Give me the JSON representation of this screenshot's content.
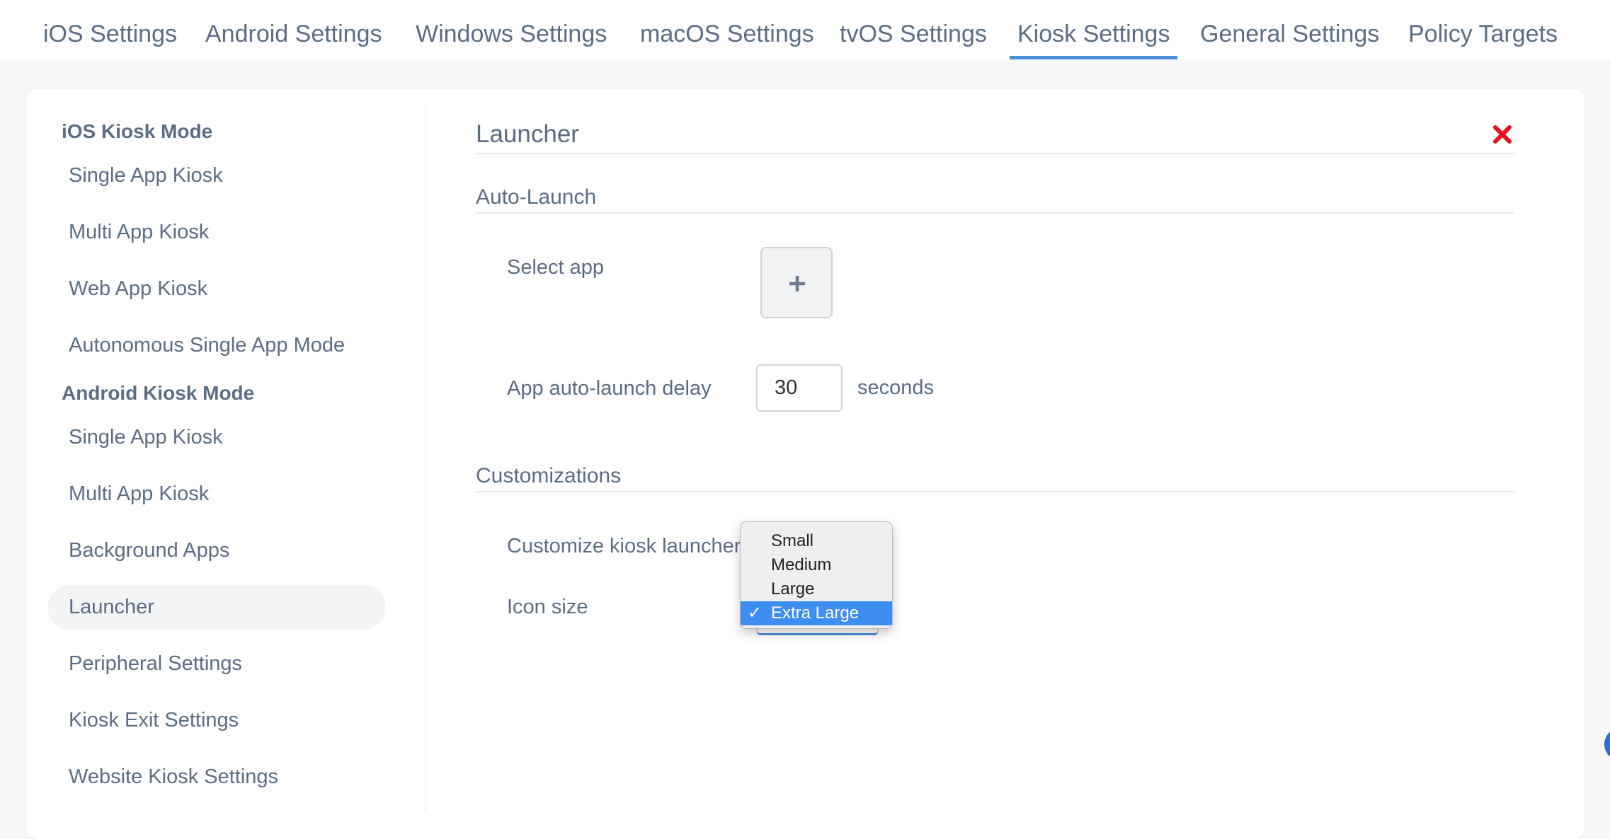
{
  "tabs": [
    {
      "label": "iOS Settings"
    },
    {
      "label": "Android Settings"
    },
    {
      "label": "Windows Settings"
    },
    {
      "label": "macOS Settings"
    },
    {
      "label": "tvOS Settings"
    },
    {
      "label": "Kiosk Settings",
      "active": true
    },
    {
      "label": "General Settings"
    },
    {
      "label": "Policy Targets"
    }
  ],
  "sidebar": {
    "ios_heading": "iOS Kiosk Mode",
    "ios_items": [
      {
        "label": "Single App Kiosk"
      },
      {
        "label": "Multi App Kiosk"
      },
      {
        "label": "Web App Kiosk"
      },
      {
        "label": "Autonomous Single App Mode"
      }
    ],
    "android_heading": "Android Kiosk Mode",
    "android_items": [
      {
        "label": "Single App Kiosk"
      },
      {
        "label": "Multi App Kiosk"
      },
      {
        "label": "Background Apps"
      },
      {
        "label": "Launcher",
        "active": true
      },
      {
        "label": "Peripheral Settings"
      },
      {
        "label": "Kiosk Exit Settings"
      },
      {
        "label": "Website Kiosk Settings"
      }
    ]
  },
  "content": {
    "title": "Launcher",
    "auto_launch": {
      "heading": "Auto-Launch",
      "select_app_label": "Select app",
      "delay_label": "App auto-launch delay",
      "delay_value": "30",
      "delay_unit": "seconds"
    },
    "customizations": {
      "heading": "Customizations",
      "customize_label": "Customize kiosk launcher",
      "icon_size_label": "Icon size",
      "icon_size_options": [
        "Small",
        "Medium",
        "Large",
        "Extra Large"
      ],
      "icon_size_selected": "Extra Large"
    }
  },
  "icons": {
    "close": "close-icon",
    "add": "plus-icon",
    "check": "✓"
  },
  "colors": {
    "accent": "#4a90d9",
    "close_red": "#e8101e",
    "selected_option": "#3d8ef0",
    "text": "#5b6d85"
  }
}
